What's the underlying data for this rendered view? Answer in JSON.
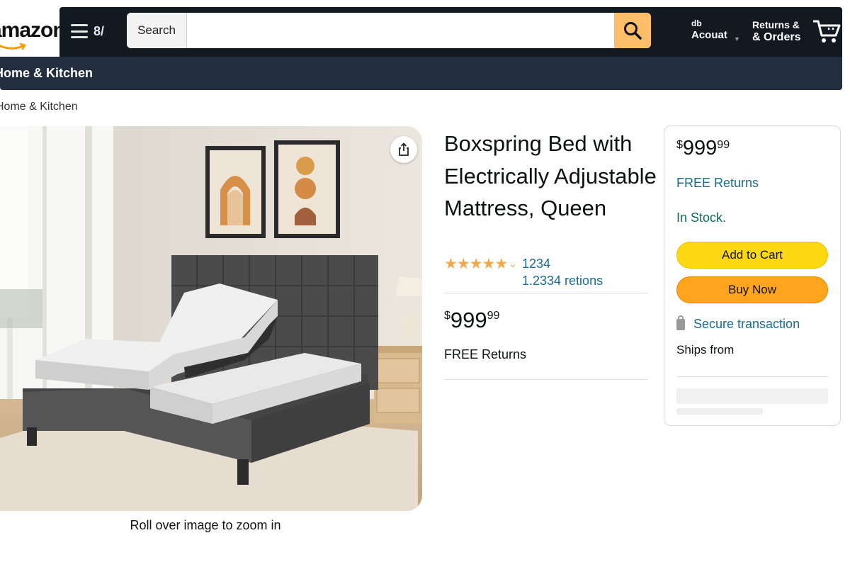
{
  "header": {
    "logo_text": "amazon",
    "menu_glyph": "8/",
    "search": {
      "category_label": "Search",
      "value": "",
      "placeholder": ""
    },
    "account": {
      "small": "db",
      "label": "Acouat"
    },
    "returns": {
      "line1": "Returns &",
      "line2": "& Orders"
    }
  },
  "subnav": {
    "department": "Home & Kitchen"
  },
  "breadcrumb": "Home & Kitchen",
  "product": {
    "title": "Boxspring Bed with Electrically Adjustable Mattress, Queen",
    "rating_stars": 5,
    "rating_count": "1234",
    "ratings_link": "1.2334 retions",
    "price": {
      "currency": "$",
      "whole": "999",
      "fraction": "99"
    },
    "free_returns": "FREE Returns",
    "zoom_hint": "Roll over image to zoom in"
  },
  "buybox": {
    "price": {
      "currency": "$",
      "whole": "999",
      "fraction": "99"
    },
    "free_returns": "FREE Returns",
    "stock": "In Stock.",
    "add_to_cart": "Add to Cart",
    "buy_now": "Buy Now",
    "secure": "Secure transaction",
    "ships_from": "Ships from"
  },
  "colors": {
    "nav_dark": "#131921",
    "nav_sub": "#232f3e",
    "search_button": "#febd69",
    "add_to_cart": "#ffd814",
    "buy_now": "#ffa41c",
    "link": "#1a6d8f",
    "star": "#f3a847"
  },
  "icons": [
    "menu-icon",
    "search-icon",
    "chevron-down-icon",
    "cart-icon",
    "share-icon",
    "lock-icon",
    "star-icon"
  ]
}
